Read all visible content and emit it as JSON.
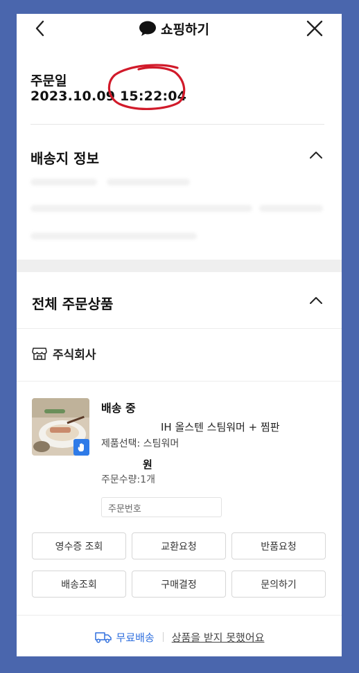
{
  "header": {
    "title": "쇼핑하기",
    "back_icon": "chevron-left-icon",
    "close_icon": "close-icon",
    "chat_icon": "speech-bubble-icon"
  },
  "order": {
    "date_label": "주문일",
    "date_value": "2023.10.09 15:22:04"
  },
  "shipping_section": {
    "title": "배송지 정보",
    "toggle_icon": "chevron-up-icon"
  },
  "products_section": {
    "title": "전체 주문상품",
    "toggle_icon": "chevron-up-icon",
    "store_icon": "store-icon",
    "shop_name": "주식회사",
    "item": {
      "status": "배송 중",
      "name": "IH 올스텐 스팀워머 + 찜판",
      "option": "제품선택: 스팀워머",
      "price_unit": "원",
      "quantity": "주문수량:1개",
      "order_number_label": "주문번호"
    }
  },
  "buttons": {
    "receipt": "영수증 조회",
    "exchange": "교환요청",
    "return": "반품요청",
    "track": "배송조회",
    "confirm": "구매결정",
    "inquiry": "문의하기"
  },
  "footer": {
    "truck_icon": "truck-icon",
    "free_shipping": "무료배송",
    "not_received": "상품을 받지 못했어요"
  },
  "colors": {
    "background": "#4a66ad",
    "accent_blue": "#2f6fde",
    "annotation_red": "#d11a2a"
  }
}
